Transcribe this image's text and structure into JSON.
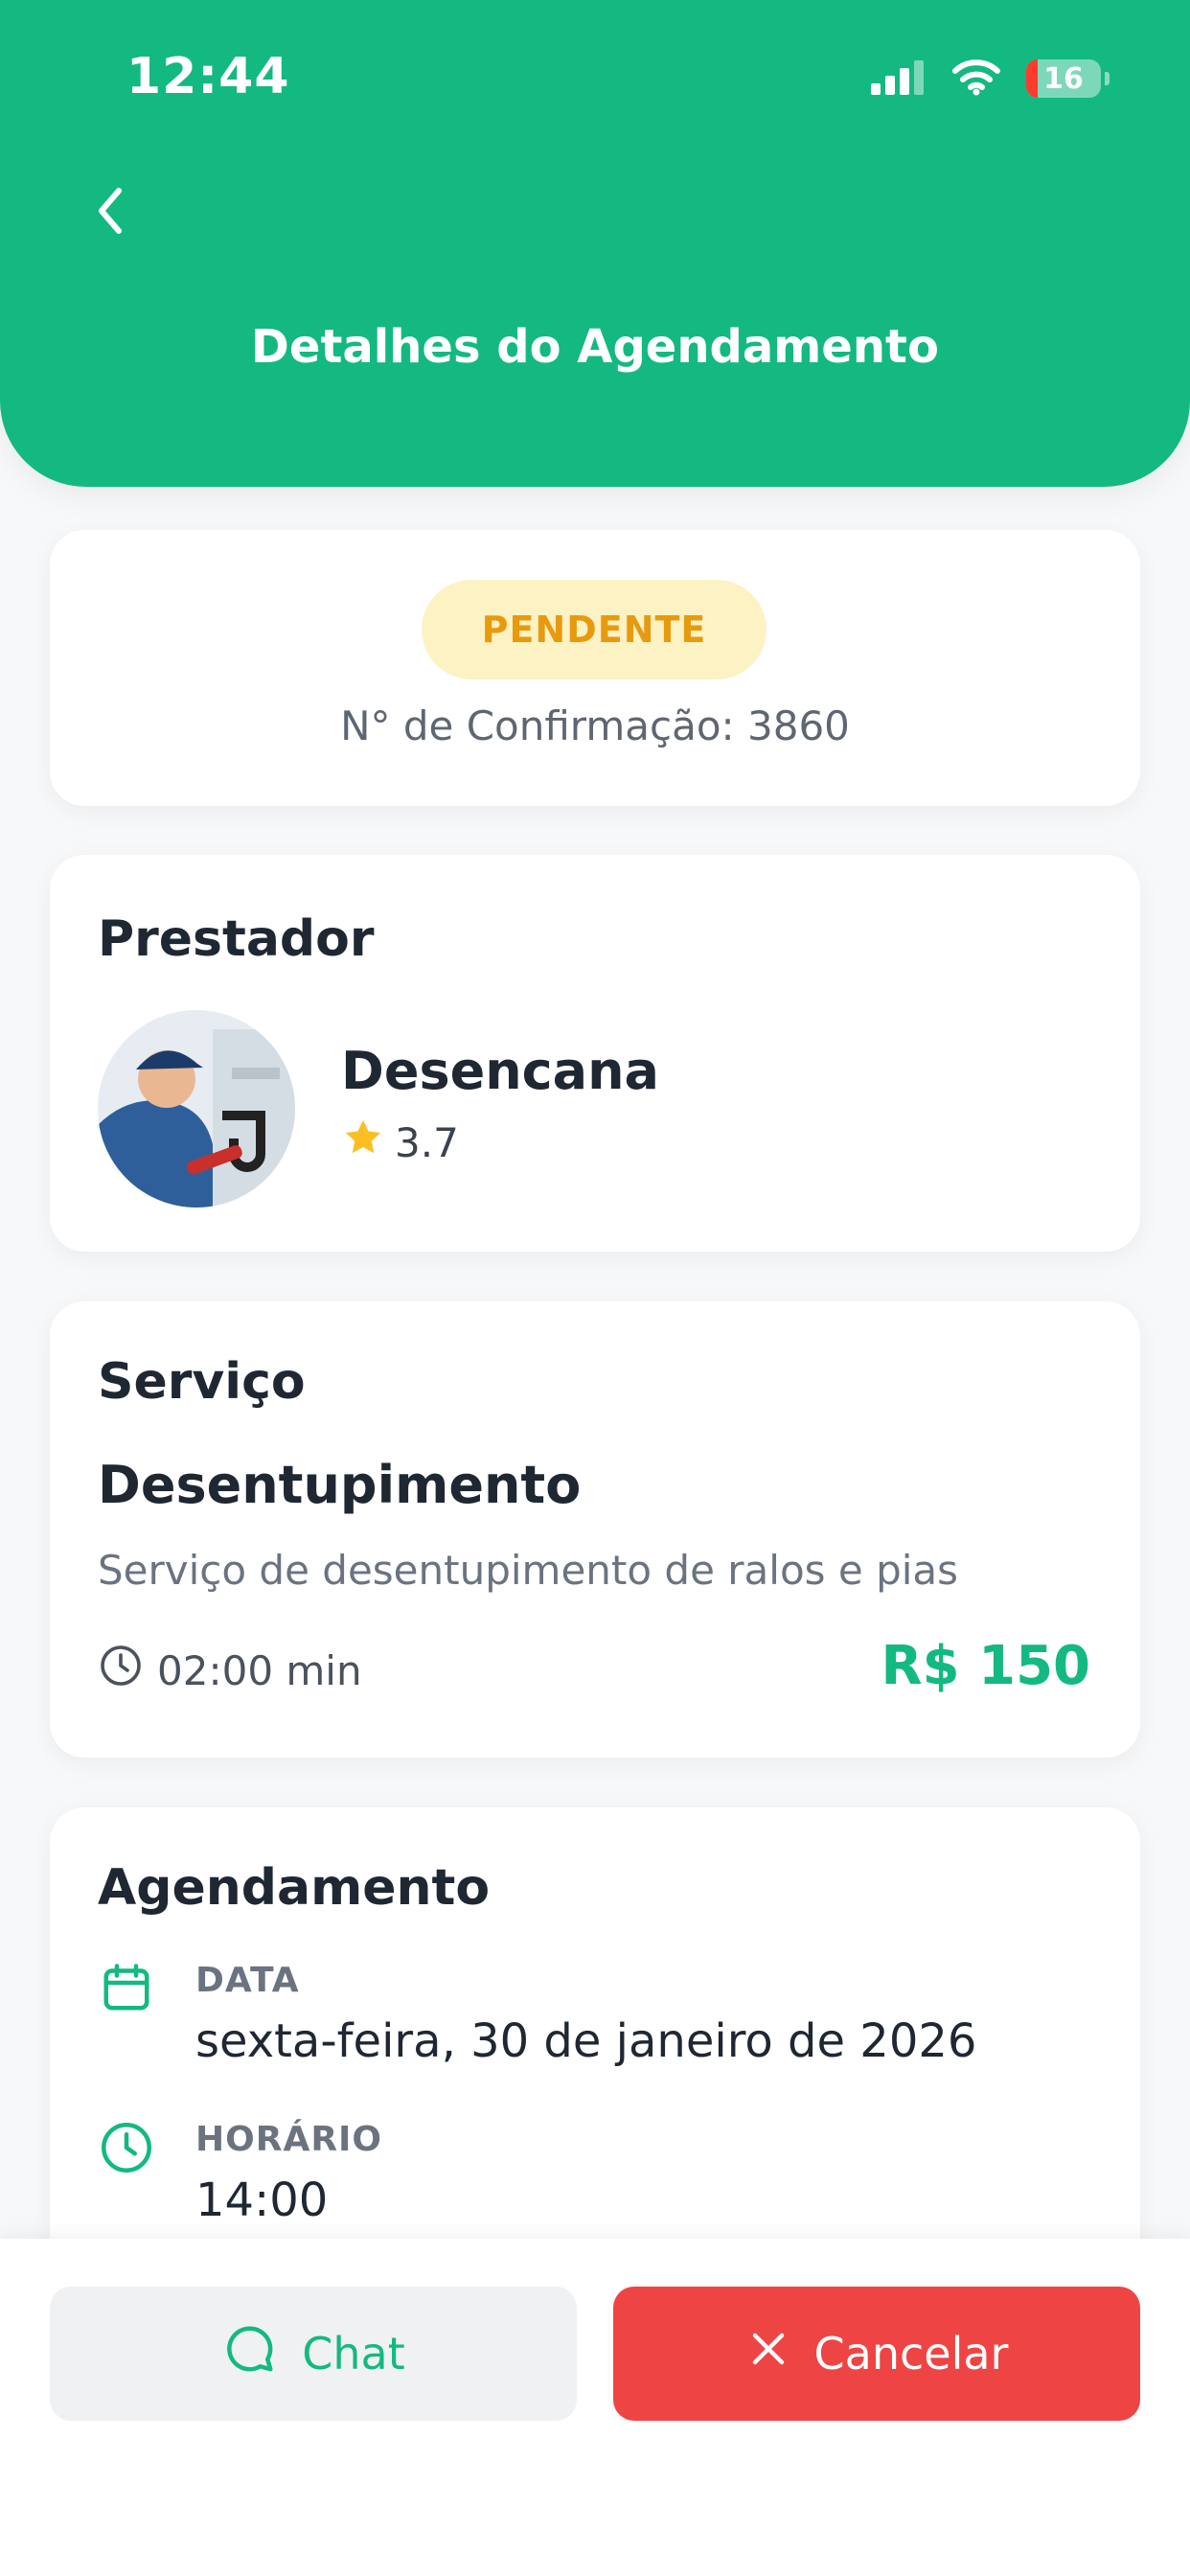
{
  "status_bar": {
    "time": "12:44",
    "battery": "16"
  },
  "header": {
    "title": "Detalhes do Agendamento"
  },
  "booking": {
    "status": "PENDENTE",
    "confirmation": "N° de Confirmação: 3860"
  },
  "provider": {
    "section_title": "Prestador",
    "name": "Desencana",
    "rating": "3.7"
  },
  "service": {
    "section_title": "Serviço",
    "name": "Desentupimento",
    "description": "Serviço de desentupimento de ralos e pias",
    "duration": "02:00 min",
    "price": "R$ 150"
  },
  "schedule": {
    "section_title": "Agendamento",
    "date_label": "DATA",
    "date_value": "sexta-feira, 30 de janeiro de 2026",
    "time_label": "HORÁRIO",
    "time_value": "14:00"
  },
  "actions": {
    "chat": "Chat",
    "cancel": "Cancelar"
  },
  "colors": {
    "brand": "#13b981",
    "pending_bg": "#fdf2c4",
    "pending_text": "#e89a0e",
    "danger": "#ef4444"
  },
  "icons": {
    "back": "chevron-left-icon",
    "signal": "signal-icon",
    "wifi": "wifi-icon",
    "battery": "battery-icon",
    "star": "star-icon",
    "clock": "clock-icon",
    "calendar": "calendar-icon",
    "chat": "chat-bubble-icon",
    "close": "close-icon"
  }
}
